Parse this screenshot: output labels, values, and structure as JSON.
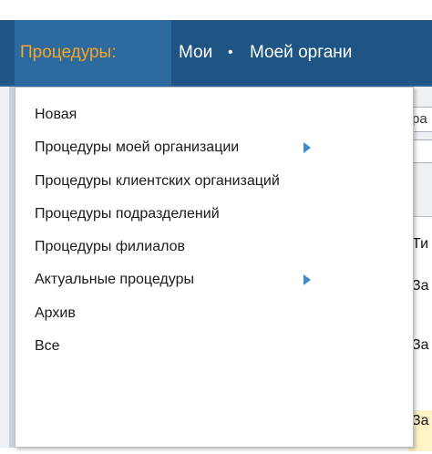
{
  "nav": {
    "active_label": "Процедуры:",
    "mine_label": "Мои",
    "separator": "•",
    "org_label": "Моей органи"
  },
  "background": {
    "field_text": "ра",
    "table_header": "Ти",
    "rows": [
      "За",
      "За",
      "За"
    ]
  },
  "menu": {
    "items": [
      {
        "label": "Новая",
        "has_submenu": false
      },
      {
        "label": "Процедуры моей организации",
        "has_submenu": true
      },
      {
        "label": "Процедуры клиентских организаций",
        "has_submenu": false
      },
      {
        "label": "Процедуры подразделений",
        "has_submenu": false
      },
      {
        "label": "Процедуры филиалов",
        "has_submenu": false
      },
      {
        "label": "Актуальные процедуры",
        "has_submenu": true
      },
      {
        "label": "Архив",
        "has_submenu": false
      },
      {
        "label": "Все",
        "has_submenu": false
      }
    ]
  },
  "colors": {
    "navbar": "#1f5585",
    "active_tab": "#2c6aa0",
    "active_text": "#f6a623",
    "submenu_arrow": "#3a8ad6"
  }
}
